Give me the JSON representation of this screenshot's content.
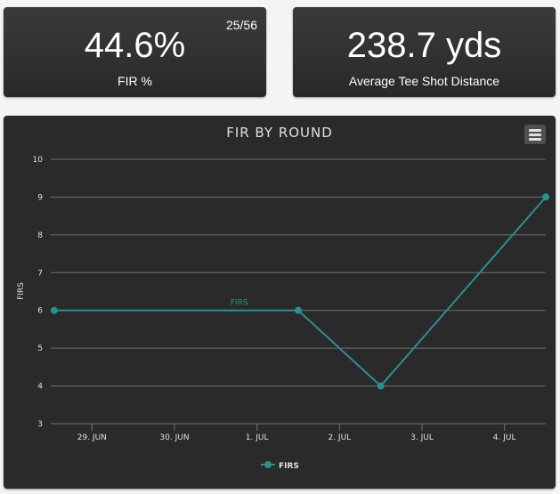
{
  "cards": {
    "fir": {
      "value": "44.6%",
      "label": "FIR %",
      "count": "25/56"
    },
    "tee": {
      "value": "238.7 yds",
      "label": "Average Tee Shot Distance"
    }
  },
  "colors": {
    "series": "#2b908f",
    "grid": "#707073",
    "text": "#e0e0e3",
    "panel": "#2a2a2b"
  },
  "menu_icon": "hamburger-menu-icon",
  "chart_data": {
    "type": "line",
    "title": "FIR BY ROUND",
    "ylabel": "FIRS",
    "xlabel": "",
    "ylim": [
      3,
      10
    ],
    "yticks": [
      3,
      4,
      5,
      6,
      7,
      8,
      9,
      10
    ],
    "xticks": [
      "29. Jun",
      "30. Jun",
      "1. Jul",
      "2. Jul",
      "3. Jul",
      "4. Jul"
    ],
    "xlim": [
      "2018-06-28T12:00",
      "2018-07-04T12:00"
    ],
    "grid": true,
    "legend": "bottom-center",
    "series": [
      {
        "name": "FIRS",
        "points": [
          {
            "x": "2018-06-28T13:00",
            "y": 6
          },
          {
            "x": "2018-07-01T12:00",
            "y": 6
          },
          {
            "x": "2018-07-02T12:00",
            "y": 4
          },
          {
            "x": "2018-07-04T12:00",
            "y": 9
          }
        ]
      }
    ],
    "annotations": [
      {
        "text": "FIRS",
        "x": "2018-07-01T00:00",
        "y": 6
      }
    ]
  }
}
